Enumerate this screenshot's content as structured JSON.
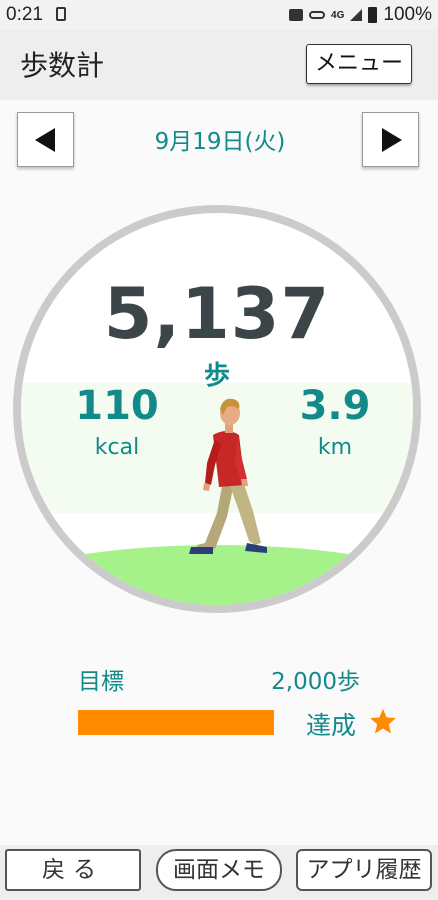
{
  "status_bar": {
    "time": "0:21",
    "network": "4G",
    "battery": "100%"
  },
  "header": {
    "title": "歩数計",
    "menu_label": "メニュー"
  },
  "date_nav": {
    "date": "9月19日(火)",
    "prev_icon": "triangle-left",
    "next_icon": "triangle-right"
  },
  "summary": {
    "steps": "5,137",
    "steps_unit": "歩",
    "kcal_value": "110",
    "kcal_unit": "kcal",
    "distance_value": "3.9",
    "distance_unit": "km"
  },
  "goal": {
    "label": "目標",
    "target": "2,000歩",
    "status": "達成",
    "progress": 1.0
  },
  "footer": {
    "back_label": "戻る",
    "memo_label": "画面メモ",
    "history_label": "アプリ履歴"
  },
  "colors": {
    "accent": "#138a8a",
    "progress": "#ff8c00",
    "grass": "#a6f28a",
    "steps_text": "#3c4649"
  }
}
